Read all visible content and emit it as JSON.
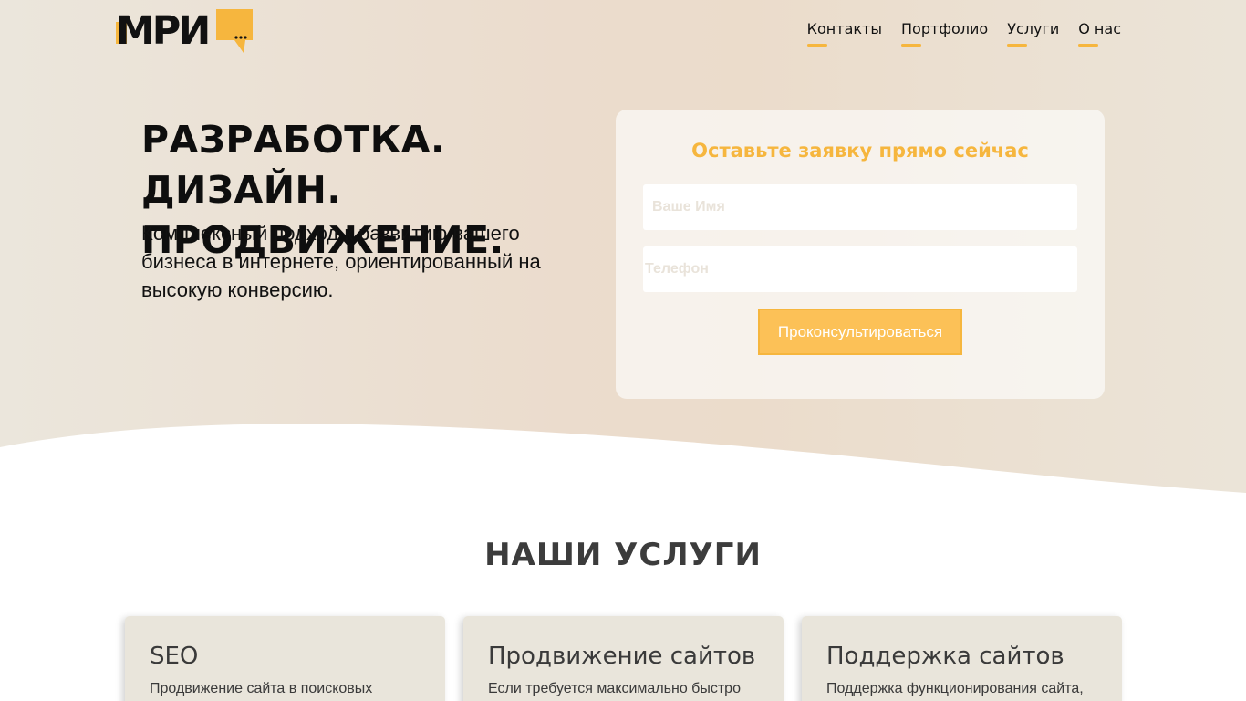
{
  "header": {
    "logo_text": "МРИ",
    "nav": [
      "Контакты",
      "Портфолио",
      "Услуги",
      "О нас"
    ]
  },
  "hero": {
    "title_line1": "РАЗРАБОТКА. ДИЗАЙН.",
    "title_line2": "ПРОДВИЖЕНИЕ.",
    "subtitle": "Комплексный подход к развитию вашего бизнеса в интернете, ориентированный на высокую конверсию."
  },
  "form": {
    "title": "Оставьте заявку прямо сейчас",
    "name_placeholder": "Ваше Имя",
    "phone_placeholder": "Телефон",
    "submit_label": "Проконсультироваться"
  },
  "services": {
    "title": "НАШИ УСЛУГИ",
    "items": [
      {
        "title": "SEO",
        "text": "Продвижение сайта в поисковых"
      },
      {
        "title": "Продвижение сайтов",
        "text": "Если требуется максимально быстро"
      },
      {
        "title": "Поддержка сайтов",
        "text": "Поддержка функционирования сайта,"
      }
    ]
  },
  "colors": {
    "accent": "#f6b63e",
    "card_bg": "#e9e5db",
    "hero_bg": "#ebdccd"
  }
}
